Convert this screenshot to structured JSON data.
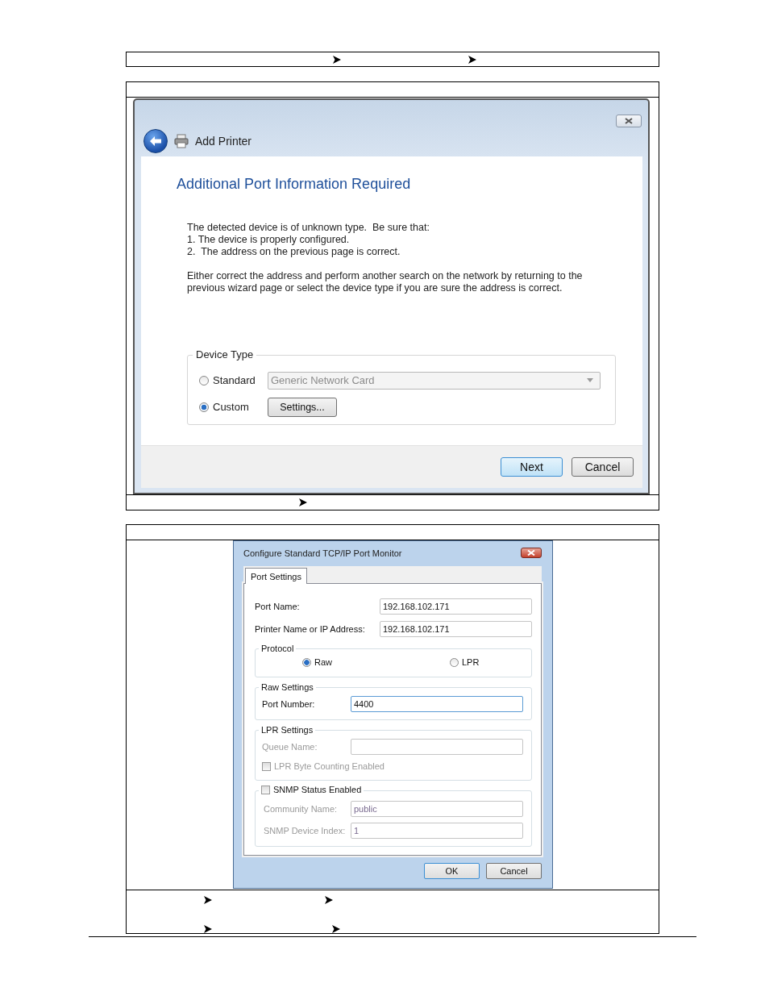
{
  "add_printer": {
    "title": "Add Printer",
    "heading": "Additional Port Information Required",
    "lines": [
      "The detected device is of unknown type.  Be sure that:",
      "1. The device is properly configured.",
      "2.  The address on the previous page is correct."
    ],
    "paragraph": "Either correct the address and perform another search on the network by returning to the previous wizard page or select the device type if you are sure the address is correct.",
    "device_type": {
      "legend": "Device Type",
      "options": [
        {
          "label": "Standard",
          "selected": false
        },
        {
          "label": "Custom",
          "selected": true
        }
      ],
      "dropdown": {
        "value": "Generic Network Card",
        "disabled": true
      },
      "settings_button": "Settings..."
    },
    "buttons": [
      {
        "label": "Next",
        "default": true
      },
      {
        "label": "Cancel",
        "default": false
      }
    ]
  },
  "port_monitor": {
    "title": "Configure Standard TCP/IP Port Monitor",
    "tabs": [
      {
        "label": "Port Settings",
        "selected": true
      }
    ],
    "fields": [
      {
        "label": "Port Name:",
        "value": "192.168.102.171"
      },
      {
        "label": "Printer Name or IP Address:",
        "value": "192.168.102.171"
      }
    ],
    "protocol": {
      "legend": "Protocol",
      "options": [
        {
          "label": "Raw",
          "selected": true
        },
        {
          "label": "LPR",
          "selected": false
        }
      ]
    },
    "raw_settings": {
      "legend": "Raw Settings",
      "label": "Port Number:",
      "value": "4400"
    },
    "lpr_settings": {
      "legend": "LPR Settings",
      "disabled": true,
      "queue_label": "Queue Name:",
      "byte_counting": {
        "label": "LPR Byte Counting Enabled",
        "checked": false
      }
    },
    "snmp": {
      "label": "SNMP Status Enabled",
      "checked": false,
      "fields": [
        {
          "label": "Community Name:",
          "value": "public"
        },
        {
          "label": "SNMP Device Index:",
          "value": "1"
        }
      ]
    },
    "buttons": [
      {
        "label": "OK",
        "default": true
      },
      {
        "label": "Cancel",
        "default": false
      }
    ]
  }
}
